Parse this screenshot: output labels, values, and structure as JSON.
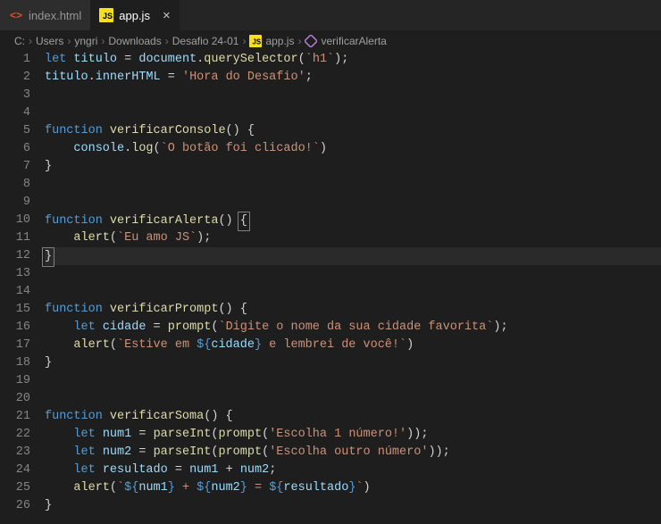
{
  "tabs": [
    {
      "icon": "html",
      "label": "index.html",
      "active": false
    },
    {
      "icon": "js",
      "label": "app.js",
      "active": true
    }
  ],
  "breadcrumb": {
    "parts": [
      "C:",
      "Users",
      "yngri",
      "Downloads",
      "Desafio 24-01"
    ],
    "fileIcon": "js",
    "file": "app.js",
    "symbolIcon": "method",
    "symbol": "verificarAlerta"
  },
  "code": {
    "lines": [
      [
        [
          "kw",
          "let"
        ],
        [
          "pn",
          " "
        ],
        [
          "var",
          "titulo"
        ],
        [
          "pn",
          " "
        ],
        [
          "op",
          "="
        ],
        [
          "pn",
          " "
        ],
        [
          "var",
          "document"
        ],
        [
          "pn",
          "."
        ],
        [
          "fn",
          "querySelector"
        ],
        [
          "pn",
          "("
        ],
        [
          "str",
          "`h1`"
        ],
        [
          "pn",
          ");"
        ]
      ],
      [
        [
          "var",
          "titulo"
        ],
        [
          "pn",
          "."
        ],
        [
          "var",
          "innerHTML"
        ],
        [
          "pn",
          " "
        ],
        [
          "op",
          "="
        ],
        [
          "pn",
          " "
        ],
        [
          "str",
          "'Hora do Desafio'"
        ],
        [
          "pn",
          ";"
        ]
      ],
      [],
      [],
      [
        [
          "kw",
          "function"
        ],
        [
          "pn",
          " "
        ],
        [
          "fn",
          "verificarConsole"
        ],
        [
          "pn",
          "() {"
        ]
      ],
      [
        [
          "pn",
          "    "
        ],
        [
          "var",
          "console"
        ],
        [
          "pn",
          "."
        ],
        [
          "fn",
          "log"
        ],
        [
          "pn",
          "("
        ],
        [
          "str",
          "`O botão foi clicado!`"
        ],
        [
          "pn",
          ")"
        ]
      ],
      [
        [
          "pn",
          "}"
        ]
      ],
      [],
      [],
      [
        [
          "kw",
          "function"
        ],
        [
          "pn",
          " "
        ],
        [
          "fn",
          "verificarAlerta"
        ],
        [
          "pn",
          "() "
        ],
        [
          "box",
          "{"
        ]
      ],
      [
        [
          "pn",
          "    "
        ],
        [
          "fn",
          "alert"
        ],
        [
          "pn",
          "("
        ],
        [
          "str",
          "`Eu amo JS`"
        ],
        [
          "pn",
          ");"
        ]
      ],
      [
        [
          "box",
          "}"
        ]
      ],
      [],
      [],
      [
        [
          "kw",
          "function"
        ],
        [
          "pn",
          " "
        ],
        [
          "fn",
          "verificarPrompt"
        ],
        [
          "pn",
          "() {"
        ]
      ],
      [
        [
          "pn",
          "    "
        ],
        [
          "kw",
          "let"
        ],
        [
          "pn",
          " "
        ],
        [
          "var",
          "cidade"
        ],
        [
          "pn",
          " "
        ],
        [
          "op",
          "="
        ],
        [
          "pn",
          " "
        ],
        [
          "fn",
          "prompt"
        ],
        [
          "pn",
          "("
        ],
        [
          "str",
          "`Digite o nome da sua cidade favorita`"
        ],
        [
          "pn",
          ");"
        ]
      ],
      [
        [
          "pn",
          "    "
        ],
        [
          "fn",
          "alert"
        ],
        [
          "pn",
          "("
        ],
        [
          "str",
          "`Estive em "
        ],
        [
          "tpl",
          "${"
        ],
        [
          "var",
          "cidade"
        ],
        [
          "tpl",
          "}"
        ],
        [
          "str",
          " e lembrei de você!`"
        ],
        [
          "pn",
          ")"
        ]
      ],
      [
        [
          "pn",
          "}"
        ]
      ],
      [],
      [],
      [
        [
          "kw",
          "function"
        ],
        [
          "pn",
          " "
        ],
        [
          "fn",
          "verificarSoma"
        ],
        [
          "pn",
          "() {"
        ]
      ],
      [
        [
          "pn",
          "    "
        ],
        [
          "kw",
          "let"
        ],
        [
          "pn",
          " "
        ],
        [
          "var",
          "num1"
        ],
        [
          "pn",
          " "
        ],
        [
          "op",
          "="
        ],
        [
          "pn",
          " "
        ],
        [
          "fn",
          "parseInt"
        ],
        [
          "pn",
          "("
        ],
        [
          "fn",
          "prompt"
        ],
        [
          "pn",
          "("
        ],
        [
          "str",
          "'Escolha 1 número!'"
        ],
        [
          "pn",
          "));"
        ]
      ],
      [
        [
          "pn",
          "    "
        ],
        [
          "kw",
          "let"
        ],
        [
          "pn",
          " "
        ],
        [
          "var",
          "num2"
        ],
        [
          "pn",
          " "
        ],
        [
          "op",
          "="
        ],
        [
          "pn",
          " "
        ],
        [
          "fn",
          "parseInt"
        ],
        [
          "pn",
          "("
        ],
        [
          "fn",
          "prompt"
        ],
        [
          "pn",
          "("
        ],
        [
          "str",
          "'Escolha outro número'"
        ],
        [
          "pn",
          "));"
        ]
      ],
      [
        [
          "pn",
          "    "
        ],
        [
          "kw",
          "let"
        ],
        [
          "pn",
          " "
        ],
        [
          "var",
          "resultado"
        ],
        [
          "pn",
          " "
        ],
        [
          "op",
          "="
        ],
        [
          "pn",
          " "
        ],
        [
          "var",
          "num1"
        ],
        [
          "pn",
          " "
        ],
        [
          "op",
          "+"
        ],
        [
          "pn",
          " "
        ],
        [
          "var",
          "num2"
        ],
        [
          "pn",
          ";"
        ]
      ],
      [
        [
          "pn",
          "    "
        ],
        [
          "fn",
          "alert"
        ],
        [
          "pn",
          "("
        ],
        [
          "str",
          "`"
        ],
        [
          "tpl",
          "${"
        ],
        [
          "var",
          "num1"
        ],
        [
          "tpl",
          "}"
        ],
        [
          "str",
          " + "
        ],
        [
          "tpl",
          "${"
        ],
        [
          "var",
          "num2"
        ],
        [
          "tpl",
          "}"
        ],
        [
          "str",
          " = "
        ],
        [
          "tpl",
          "${"
        ],
        [
          "var",
          "resultado"
        ],
        [
          "tpl",
          "}"
        ],
        [
          "str",
          "`"
        ],
        [
          "pn",
          ")"
        ]
      ],
      [
        [
          "pn",
          "}"
        ]
      ]
    ],
    "highlight": 12
  }
}
